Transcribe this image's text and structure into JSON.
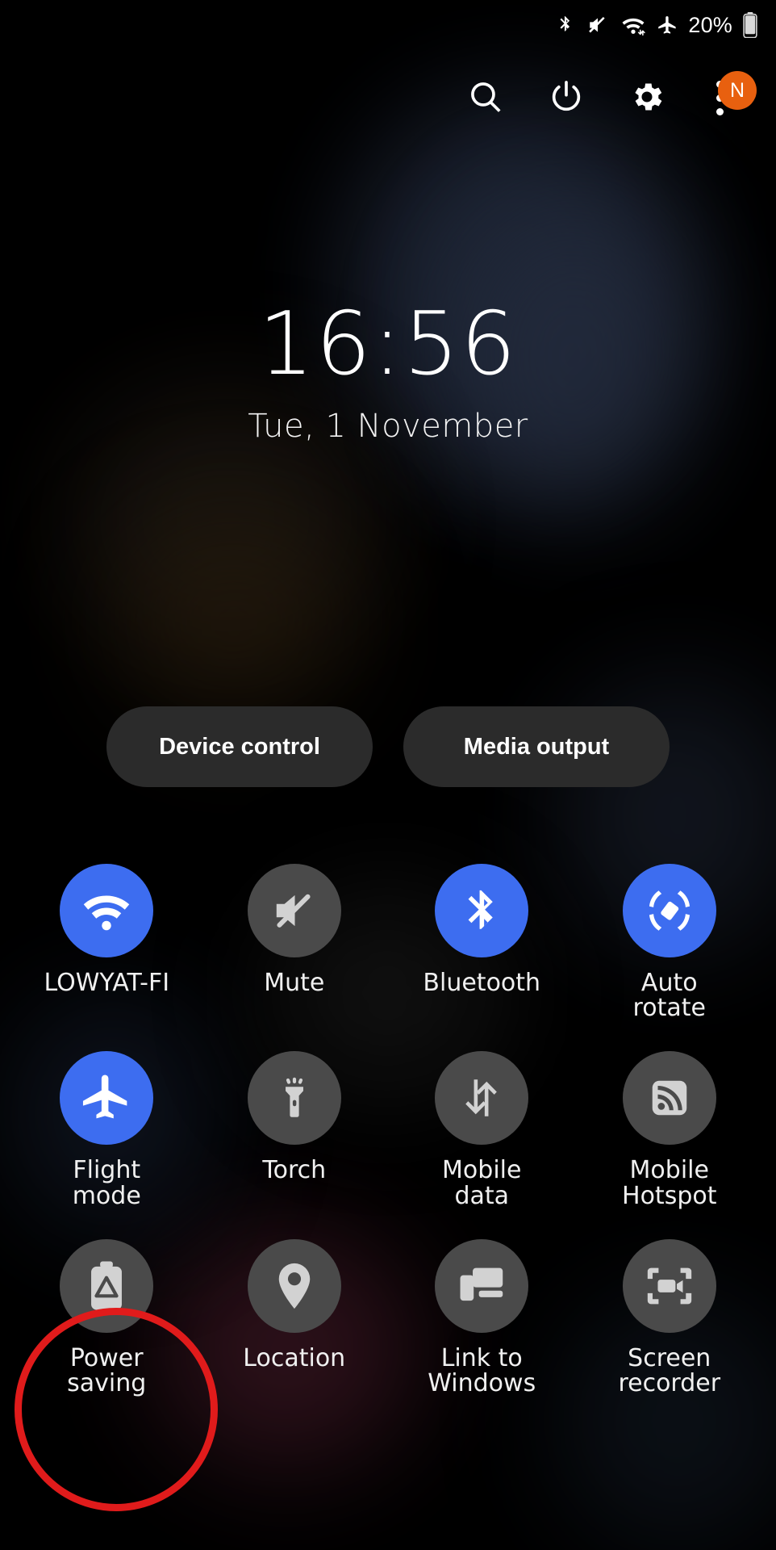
{
  "colors": {
    "accent_on": "#3d6df0",
    "tile_off": "#4a4a4a",
    "badge_orange": "#e8600f",
    "annotation_red": "#e01b1b",
    "background": "#000000",
    "pill_bg": "#2b2b2b"
  },
  "status_bar": {
    "icons": [
      "bluetooth-icon",
      "mute-icon",
      "wifi-icon",
      "airplane-icon"
    ],
    "battery_percent": "20%",
    "battery_icon": "battery-icon"
  },
  "header": {
    "actions": [
      {
        "name": "search-icon",
        "label": "Search"
      },
      {
        "name": "power-icon",
        "label": "Power off"
      },
      {
        "name": "settings-gear-icon",
        "label": "Settings"
      },
      {
        "name": "overflow-menu-icon",
        "label": "More options"
      }
    ],
    "badge_text": "N"
  },
  "clock": {
    "time": "16:56",
    "date": "Tue, 1 November"
  },
  "pills": [
    {
      "label": "Device control"
    },
    {
      "label": "Media output"
    }
  ],
  "tiles": [
    {
      "label": "LOWYAT-FI",
      "icon": "wifi-icon",
      "state": "on"
    },
    {
      "label": "Mute",
      "icon": "volume-mute-icon",
      "state": "off"
    },
    {
      "label": "Bluetooth",
      "icon": "bluetooth-icon",
      "state": "on"
    },
    {
      "label": "Auto\nrotate",
      "icon": "auto-rotate-icon",
      "state": "on"
    },
    {
      "label": "Flight\nmode",
      "icon": "airplane-icon",
      "state": "on"
    },
    {
      "label": "Torch",
      "icon": "flashlight-icon",
      "state": "off"
    },
    {
      "label": "Mobile\ndata",
      "icon": "mobile-data-icon",
      "state": "off"
    },
    {
      "label": "Mobile\nHotspot",
      "icon": "hotspot-icon",
      "state": "off"
    },
    {
      "label": "Power\nsaving",
      "icon": "power-saving-icon",
      "state": "off"
    },
    {
      "label": "Location",
      "icon": "location-pin-icon",
      "state": "off"
    },
    {
      "label": "Link to\nWindows",
      "icon": "link-to-windows-icon",
      "state": "off"
    },
    {
      "label": "Screen\nrecorder",
      "icon": "screen-recorder-icon",
      "state": "off"
    }
  ],
  "annotation": {
    "type": "circle-highlight",
    "target_label": "Power saving"
  }
}
